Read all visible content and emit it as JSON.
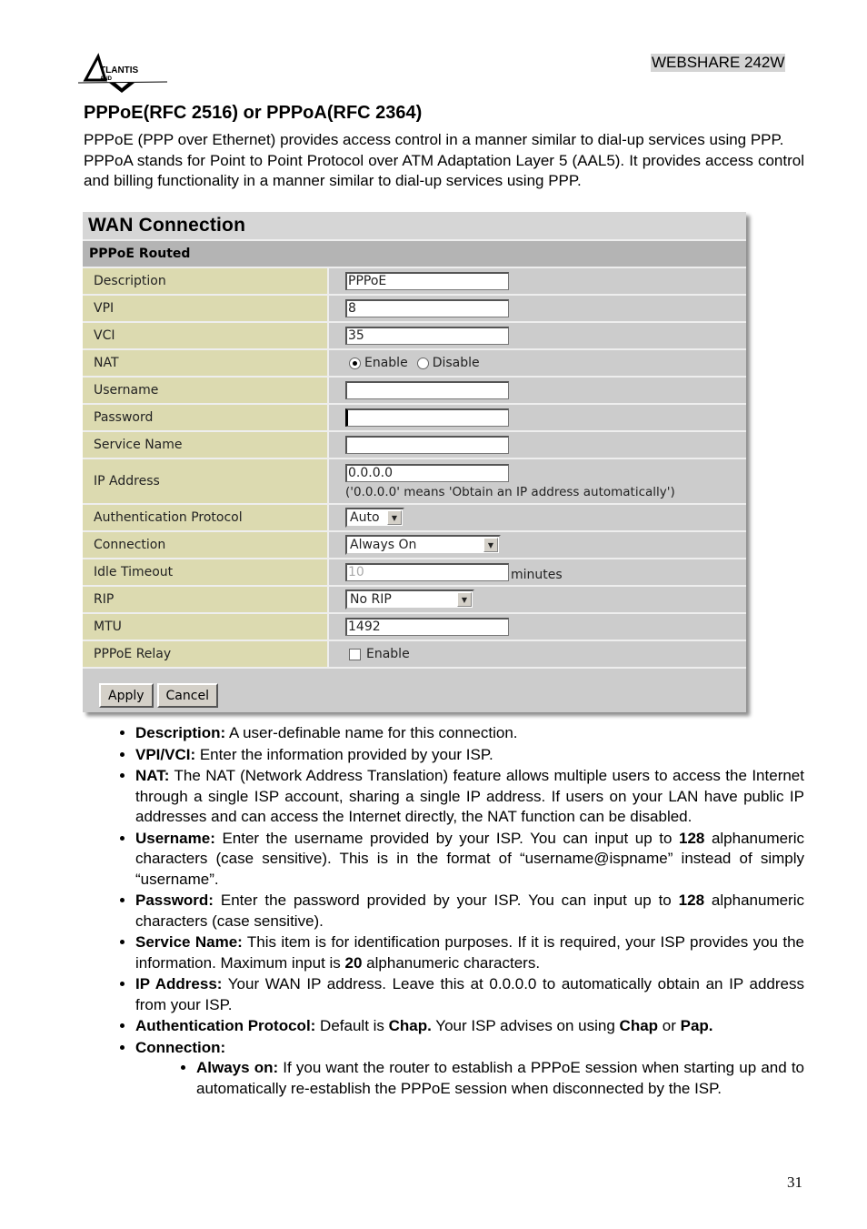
{
  "header": {
    "product_name": "WEBSHARE 242W",
    "brand": "ATLANTIS LAND"
  },
  "section_title": "PPPoE(RFC 2516) or PPPoA(RFC 2364)",
  "intro": [
    "PPPoE (PPP over Ethernet) provides access control in a manner similar to dial-up services using PPP.",
    "PPPoA stands for Point to Point Protocol over ATM Adaptation Layer 5 (AAL5). It provides access control and billing functionality in a manner similar to dial-up services using PPP."
  ],
  "wan": {
    "title": "WAN Connection",
    "subtitle": "PPPoE Routed",
    "fields": {
      "description": {
        "label": "Description",
        "value": "PPPoE"
      },
      "vpi": {
        "label": "VPI",
        "value": "8"
      },
      "vci": {
        "label": "VCI",
        "value": "35"
      },
      "nat": {
        "label": "NAT",
        "options": [
          "Enable",
          "Disable"
        ],
        "selected": "Enable"
      },
      "username": {
        "label": "Username",
        "value": ""
      },
      "password": {
        "label": "Password",
        "value": ""
      },
      "service_name": {
        "label": "Service Name",
        "value": ""
      },
      "ip_address": {
        "label": "IP Address",
        "value": "0.0.0.0",
        "hint": "('0.0.0.0' means 'Obtain an IP address automatically')"
      },
      "auth_protocol": {
        "label": "Authentication Protocol",
        "selected": "Auto"
      },
      "connection": {
        "label": "Connection",
        "selected": "Always On"
      },
      "idle_timeout": {
        "label": "Idle Timeout",
        "value": "10",
        "unit": "minutes"
      },
      "rip": {
        "label": "RIP",
        "selected": "No RIP"
      },
      "mtu": {
        "label": "MTU",
        "value": "1492"
      },
      "pppoe_relay": {
        "label": "PPPoE Relay",
        "option": "Enable",
        "checked": false
      }
    },
    "buttons": {
      "apply": "Apply",
      "cancel": "Cancel"
    },
    "colors": {
      "label_bg": "#dcdab0",
      "panel_bg": "#cccccc",
      "subheader_bg": "#b4b4b4"
    }
  },
  "bullets": [
    {
      "term": "Description:",
      "text": " A user-definable name for this connection."
    },
    {
      "term": "VPI/VCI:",
      "text": " Enter the information provided by your ISP."
    },
    {
      "term": "NAT:",
      "text": " The NAT (Network Address Translation) feature allows multiple users to access the Internet through a single ISP account, sharing a single IP address. If users on your LAN have public IP addresses and can access the Internet directly, the NAT function can be disabled."
    },
    {
      "term": "Username:",
      "text_a": " Enter the username provided by your ISP. You can input up to ",
      "bold": "128",
      "text_b": " alphanumeric characters (case sensitive). This is in the format of “username@ispname” instead of simply “username”."
    },
    {
      "term": "Password:",
      "text_a": " Enter the password provided by your ISP. You can input up to ",
      "bold": "128",
      "text_b": " alphanumeric characters (case sensitive)."
    },
    {
      "term": "Service Name:",
      "text_a": " This item is for identification purposes. If it is required, your ISP provides you the information. Maximum input is ",
      "bold": "20",
      "text_b": " alphanumeric characters."
    },
    {
      "term": "IP Address:",
      "text": " Your WAN IP address. Leave this at 0.0.0.0 to automatically obtain an IP address from your ISP."
    },
    {
      "term": "Authentication Protocol:",
      "text_a": " Default is ",
      "bold": "Chap.",
      "text_b": " Your ISP advises on using ",
      "bold2": "Chap",
      "text_c": " or ",
      "bold3": "Pap."
    },
    {
      "term": "Connection:"
    },
    {
      "term": "Always on:",
      "text": " If you want the router to establish a PPPoE session when starting up and to automatically re-establish the PPPoE session when disconnected by the ISP."
    }
  ],
  "page_number": "31"
}
